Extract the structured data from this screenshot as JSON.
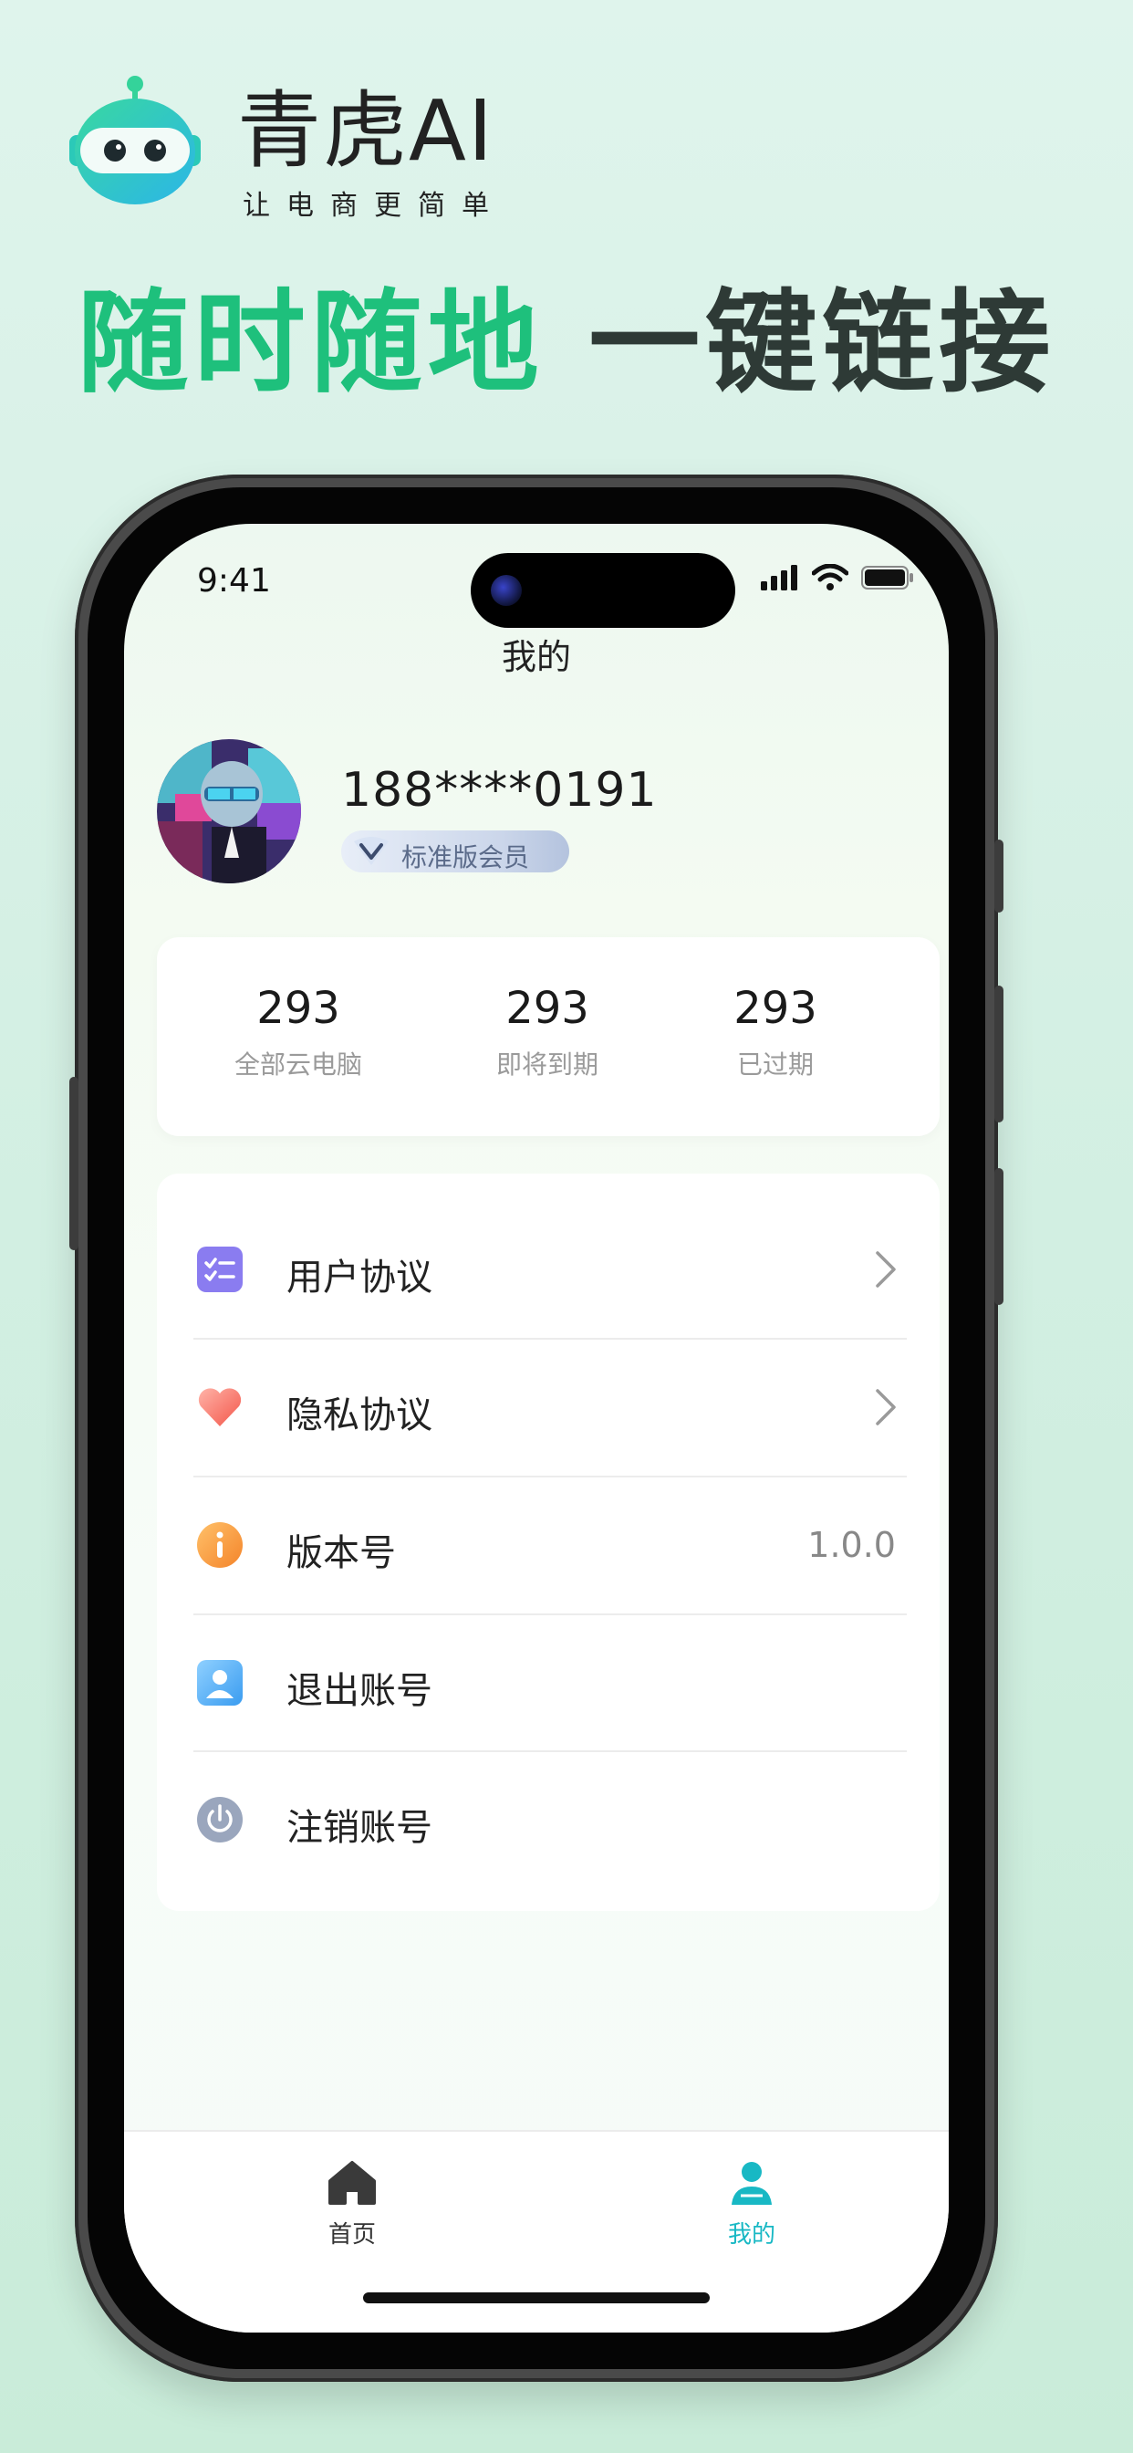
{
  "brand": {
    "name": "青虎AI",
    "slogan": "让电商更简单"
  },
  "headline": {
    "green_part": "随时随地",
    "dark_part": "一键链接"
  },
  "status_bar": {
    "time": "9:41"
  },
  "page": {
    "title": "我的"
  },
  "profile": {
    "phone": "188****0191",
    "membership": "标准版会员"
  },
  "stats": [
    {
      "value": "293",
      "label": "全部云电脑"
    },
    {
      "value": "293",
      "label": "即将到期"
    },
    {
      "value": "293",
      "label": "已过期"
    }
  ],
  "menu": [
    {
      "label": "用户协议",
      "icon": "checklist-icon"
    },
    {
      "label": "隐私协议",
      "icon": "heart-icon"
    },
    {
      "label": "版本号",
      "icon": "info-icon",
      "value": "1.0.0"
    },
    {
      "label": "退出账号",
      "icon": "user-icon"
    },
    {
      "label": "注销账号",
      "icon": "power-icon"
    }
  ],
  "tabbar": {
    "home": "首页",
    "mine": "我的"
  },
  "colors": {
    "accent_green": "#1ec07c",
    "tab_active": "#18b8c4",
    "tab_inactive": "#333333"
  }
}
